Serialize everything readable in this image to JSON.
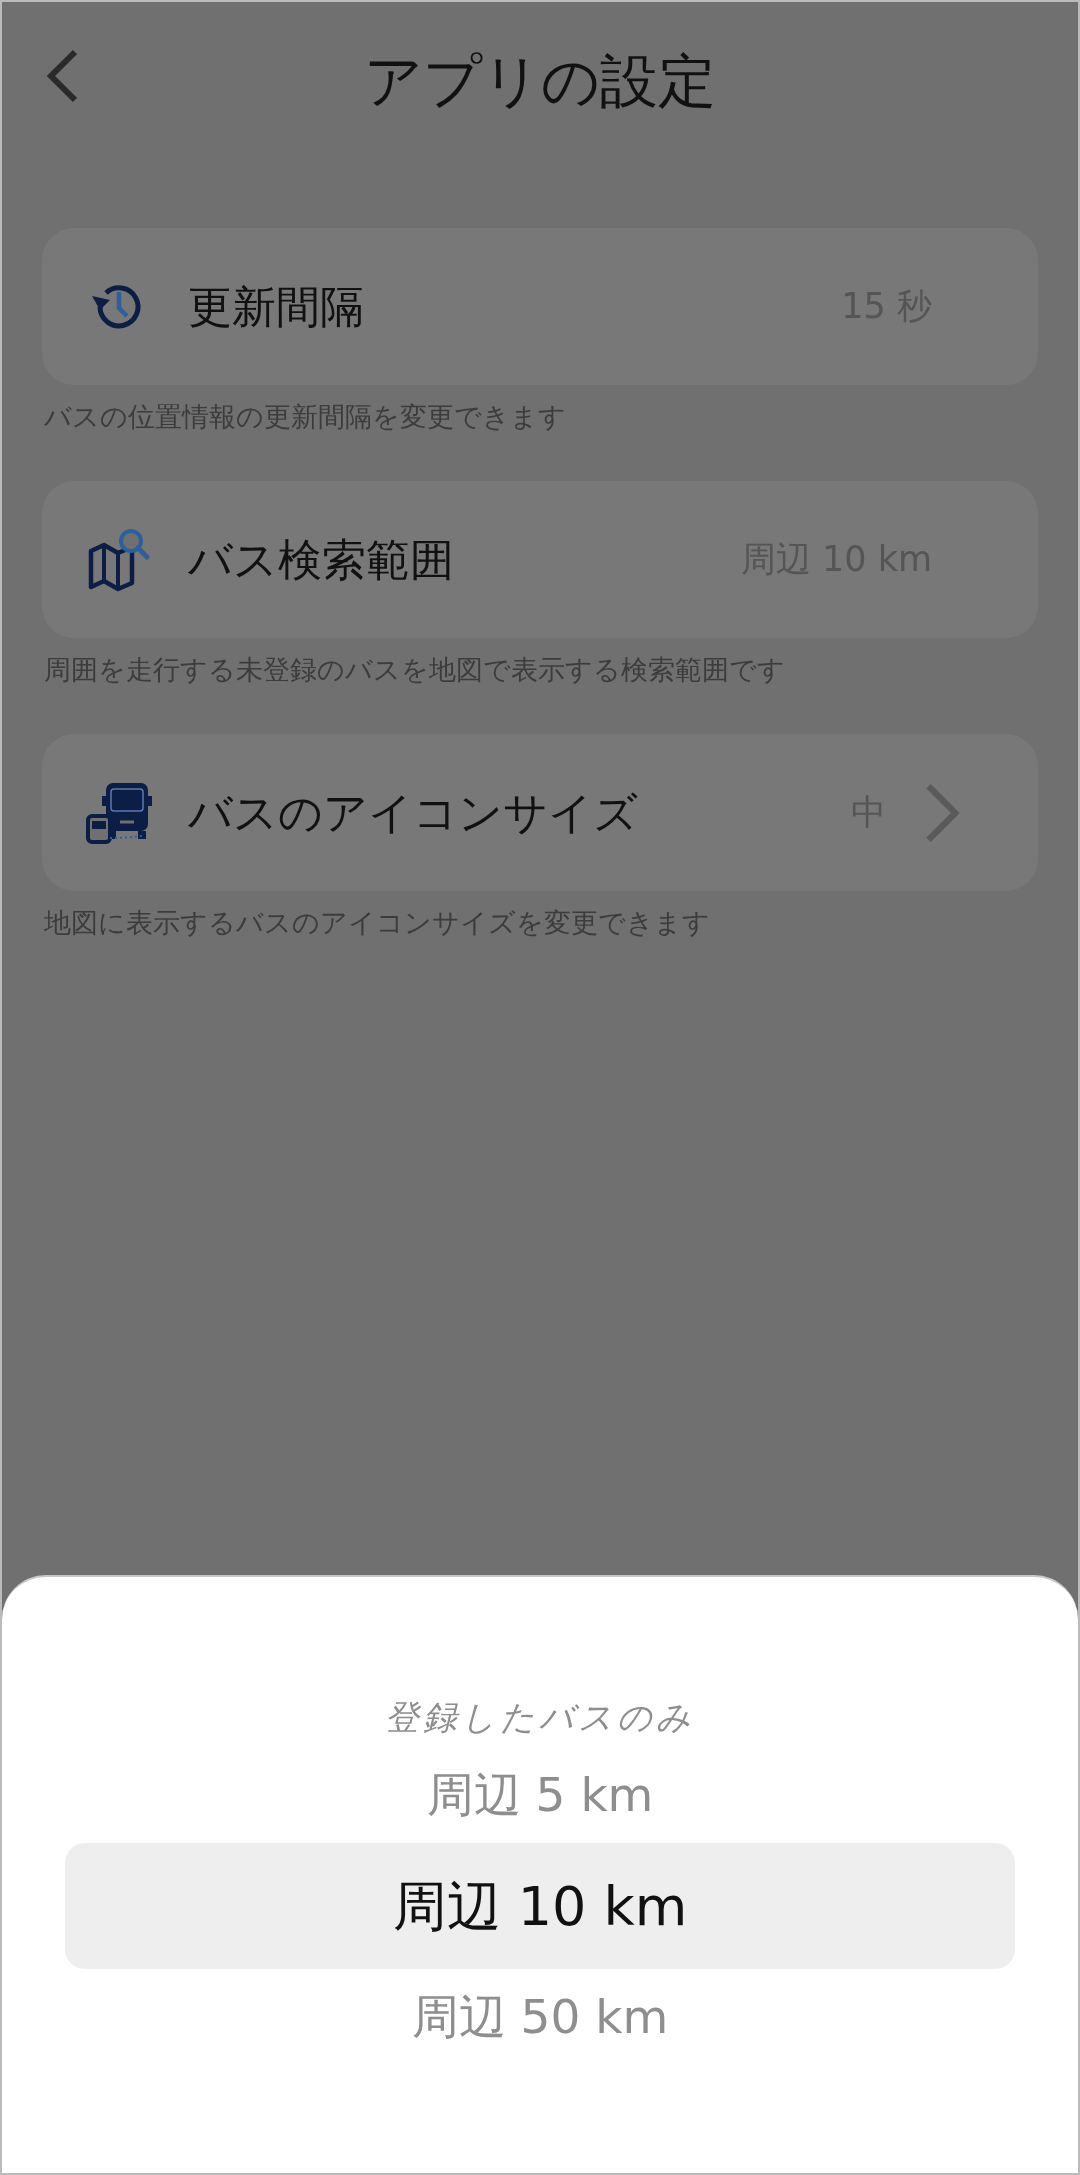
{
  "header": {
    "title": "アプリの設定"
  },
  "settings": [
    {
      "label": "更新間隔",
      "value": "15 秒",
      "chevron": false,
      "description": "バスの位置情報の更新間隔を変更できます"
    },
    {
      "label": "バス検索範囲",
      "value": "周辺 10 km",
      "chevron": false,
      "description": "周囲を走行する未登録のバスを地図で表示する検索範囲です"
    },
    {
      "label": "バスのアイコンサイズ",
      "value": "中",
      "chevron": true,
      "description": "地図に表示するバスのアイコンサイズを変更できます"
    }
  ],
  "picker": {
    "options": [
      {
        "label": "登録したバスのみ",
        "selected": false
      },
      {
        "label": "周辺 5 km",
        "selected": false
      },
      {
        "label": "周辺 10 km",
        "selected": true
      },
      {
        "label": "周辺 50 km",
        "selected": false
      }
    ]
  }
}
